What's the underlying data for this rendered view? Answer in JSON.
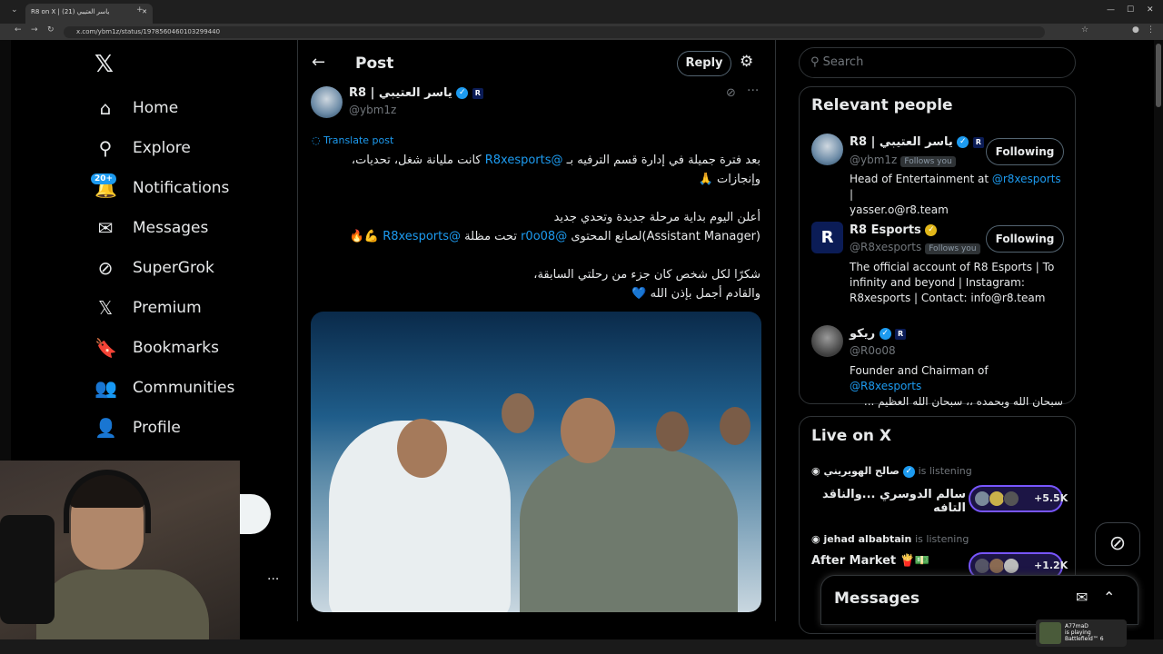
{
  "browser": {
    "tab_title": "R8 on X | ياسر العتيبي (21)",
    "url": "x.com/ybm1z/status/1978560460103299440"
  },
  "sidebar": {
    "items": [
      {
        "label": "Home",
        "icon": "home-icon"
      },
      {
        "label": "Explore",
        "icon": "search-icon"
      },
      {
        "label": "Notifications",
        "icon": "bell-icon"
      },
      {
        "label": "Messages",
        "icon": "envelope-icon"
      },
      {
        "label": "SuperGrok",
        "icon": "grok-icon"
      },
      {
        "label": "Premium",
        "icon": "x-icon"
      },
      {
        "label": "Bookmarks",
        "icon": "bookmark-icon"
      },
      {
        "label": "Communities",
        "icon": "people-icon"
      },
      {
        "label": "Profile",
        "icon": "person-icon"
      }
    ],
    "notification_badge": "20+",
    "more_label": "···"
  },
  "post": {
    "header_title": "Post",
    "reply_label": "Reply",
    "author_name": "R8 | ياسر العتيبي",
    "author_handle": "@ybm1z",
    "translate_label": "Translate post",
    "p1_a": "بعد فترة جميلة في إدارة قسم الترفيه بـ ",
    "p1_mention": "@R8xesports",
    "p1_b": " كانت مليانة شغل، تحديات،",
    "p1_line2": "وإنجازات 🙏",
    "p2_line1": "أعلن اليوم بداية مرحلة جديدة وتحدي جديد",
    "p2_a": "(Assistant Manager)لصانع المحتوى ",
    "p2_mention1": "@r0o08",
    "p2_b": " تحت مظلة ",
    "p2_mention2": "@R8xesports",
    "p2_c": " 💪🔥",
    "p3_line1": "شكرًا لكل شخص كان جزء من رحلتي السابقة،",
    "p3_line2": "والقادم أجمل بإذن الله 💙"
  },
  "search": {
    "placeholder": "Search"
  },
  "relevant_people": {
    "title": "Relevant people",
    "people": [
      {
        "name": "R8 | ياسر العتيبي",
        "handle": "@ybm1z",
        "follows_you": "Follows you",
        "button": "Following",
        "bio_a": "Head of Entertainment at ",
        "bio_mention": "@r8xesports",
        "bio_b": " |",
        "bio_line2": "yasser.o@r8.team"
      },
      {
        "name": "R8 Esports",
        "handle": "@R8xesports",
        "follows_you": "Follows you",
        "button": "Following",
        "bio_line1": "The official account of R8 Esports | To",
        "bio_line2": "infinity and beyond | Instagram:",
        "bio_line3": "R8xesports | Contact: info@r8.team"
      },
      {
        "name": "ريكو",
        "handle": "@R0o08",
        "bio_a": "Founder and Chairman of ",
        "bio_mention": "@R8xesports",
        "bio_line2": "سبحان الله وبحمده ،، سبحان الله العظيم ..."
      }
    ]
  },
  "live": {
    "title": "Live on X",
    "spaces": [
      {
        "host": "صالح الهويريني",
        "status": "is listening",
        "title": "سالم الدوسري ...والناقد التافه",
        "count": "+5.5K"
      },
      {
        "host": "jehad albabtain",
        "status": "is listening",
        "title": "After Market 🍟💵",
        "count": "+1.2K"
      }
    ]
  },
  "messages_drawer": {
    "title": "Messages"
  },
  "game_overlay": {
    "name": "A77maD",
    "status": "is playing",
    "game": "Battlefield™ 6"
  }
}
